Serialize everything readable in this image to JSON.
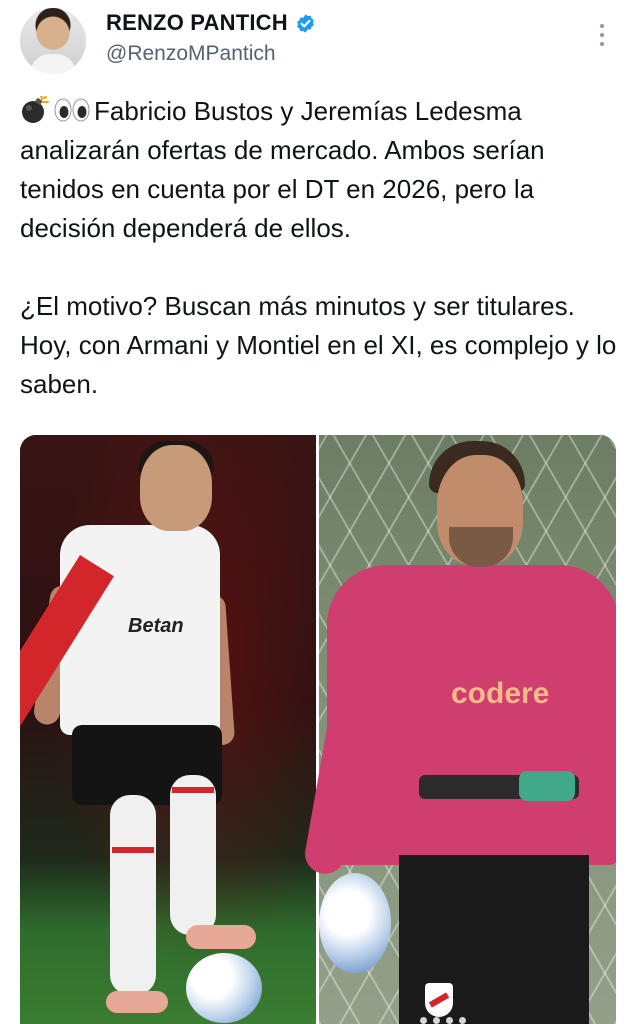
{
  "author": {
    "display_name": "RENZO PANTICH",
    "handle": "@RenzoMPantich",
    "verified": true
  },
  "tweet": {
    "emojis": [
      "bomb-emoji",
      "eyes-emoji"
    ],
    "paragraph_1": "Fabricio Bustos y Jeremías Ledesma analizarán ofertas de mercado. Ambos serían tenidos en cuenta por el DT en 2026, pero la decisión dependerá de ellos.",
    "paragraph_2": "¿El motivo? Buscan más minutos y ser titulares. Hoy, con Armani y Montiel en el XI, es complejo y lo saben."
  },
  "media": {
    "left_photo": {
      "sponsor_text": "Betan"
    },
    "right_photo": {
      "sponsor_text": "codere"
    }
  },
  "colors": {
    "accent_verified": "#1d9bf0",
    "text_secondary": "#536471"
  }
}
